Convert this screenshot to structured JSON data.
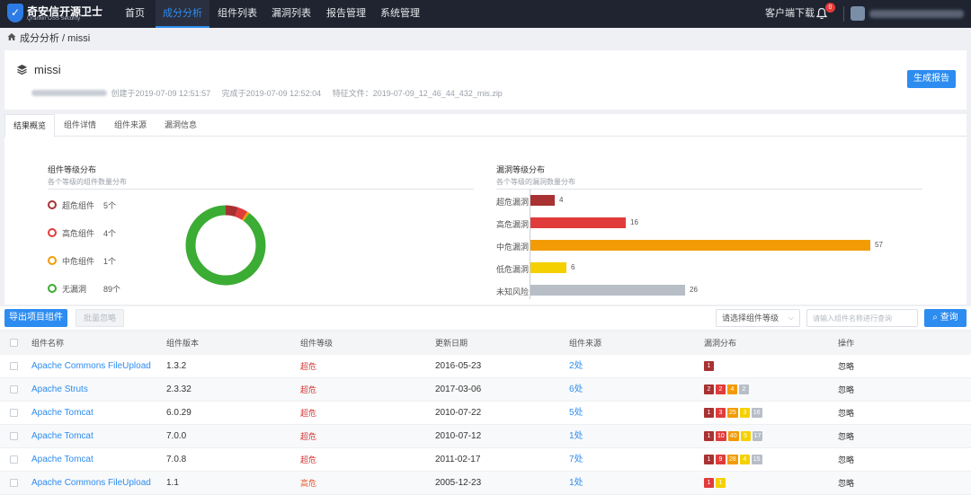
{
  "colors": {
    "accent": "#2d8cf0",
    "critical": "#a83232",
    "high": "#e03c3c",
    "medium": "#f29b05",
    "low": "#f5d000",
    "unknown": "#b8bec6",
    "safe": "#3bac34"
  },
  "nav": {
    "logo_title": "奇安信开源卫士",
    "logo_subtitle": "Qi'anxin OSS Security",
    "items": [
      "首页",
      "成分分析",
      "组件列表",
      "漏洞列表",
      "报告管理",
      "系统管理"
    ],
    "active_index": 1,
    "client_download": "客户端下载",
    "notification_count": "0"
  },
  "breadcrumb": "成分分析 / missi",
  "project": {
    "name": "missi",
    "created": "创建于2019-07-09 12:51:57",
    "completed": "完成于2019-07-09 12:52:04",
    "feature_file": "特征文件：2019-07-09_12_46_44_432_mis.zip",
    "generate_report": "生成报告"
  },
  "tabs": [
    "结果概览",
    "组件详情",
    "组件来源",
    "漏洞信息"
  ],
  "component_dist": {
    "title": "组件等级分布",
    "subtitle": "各个等级的组件数量分布",
    "legend": [
      {
        "label": "超危组件",
        "count": "5个",
        "value": 5,
        "color": "#a83232"
      },
      {
        "label": "高危组件",
        "count": "4个",
        "value": 4,
        "color": "#e03c3c"
      },
      {
        "label": "中危组件",
        "count": "1个",
        "value": 1,
        "color": "#f29b05"
      },
      {
        "label": "无漏洞",
        "count": "89个",
        "value": 89,
        "color": "#3bac34"
      }
    ]
  },
  "vuln_dist": {
    "title": "漏洞等级分布",
    "subtitle": "各个等级的漏洞数量分布"
  },
  "chart_data": {
    "type": "bar",
    "orientation": "horizontal",
    "categories": [
      "超危漏洞",
      "高危漏洞",
      "中危漏洞",
      "低危漏洞",
      "未知风险"
    ],
    "values": [
      4,
      16,
      57,
      6,
      26
    ],
    "colors": [
      "#a83232",
      "#e03c3c",
      "#f29b05",
      "#f5d000",
      "#b8bec6"
    ],
    "xlim": [
      0,
      60
    ]
  },
  "toolbar": {
    "export": "导出项目组件",
    "batch_ignore": "批量忽略",
    "level_select": "请选择组件等级",
    "search_placeholder": "请输入组件名称进行查询",
    "query": "查询"
  },
  "table": {
    "headers": [
      "组件名称",
      "组件版本",
      "组件等级",
      "更新日期",
      "组件来源",
      "漏洞分布",
      "操作"
    ],
    "rows": [
      {
        "name": "Apache Commons FileUpload",
        "version": "1.3.2",
        "level": "超危",
        "level_type": "crit",
        "date": "2016-05-23",
        "source": "2处",
        "action": "忽略",
        "vulns": [
          {
            "v": "1",
            "c": "#a83232"
          }
        ]
      },
      {
        "name": "Apache Struts",
        "version": "2.3.32",
        "level": "超危",
        "level_type": "crit",
        "date": "2017-03-06",
        "source": "6处",
        "action": "忽略",
        "vulns": [
          {
            "v": "2",
            "c": "#a83232"
          },
          {
            "v": "2",
            "c": "#e03c3c"
          },
          {
            "v": "4",
            "c": "#f29b05"
          },
          {
            "v": "2",
            "c": "#b8bec6"
          }
        ]
      },
      {
        "name": "Apache Tomcat",
        "version": "6.0.29",
        "level": "超危",
        "level_type": "crit",
        "date": "2010-07-22",
        "source": "5处",
        "action": "忽略",
        "vulns": [
          {
            "v": "1",
            "c": "#a83232"
          },
          {
            "v": "3",
            "c": "#e03c3c"
          },
          {
            "v": "25",
            "c": "#f29b05"
          },
          {
            "v": "3",
            "c": "#f5d000"
          },
          {
            "v": "16",
            "c": "#b8bec6"
          }
        ]
      },
      {
        "name": "Apache Tomcat",
        "version": "7.0.0",
        "level": "超危",
        "level_type": "crit",
        "date": "2010-07-12",
        "source": "1处",
        "action": "忽略",
        "vulns": [
          {
            "v": "1",
            "c": "#a83232"
          },
          {
            "v": "10",
            "c": "#e03c3c"
          },
          {
            "v": "40",
            "c": "#f29b05"
          },
          {
            "v": "5",
            "c": "#f5d000"
          },
          {
            "v": "17",
            "c": "#b8bec6"
          }
        ]
      },
      {
        "name": "Apache Tomcat",
        "version": "7.0.8",
        "level": "超危",
        "level_type": "crit",
        "date": "2011-02-17",
        "source": "7处",
        "action": "忽略",
        "vulns": [
          {
            "v": "1",
            "c": "#a83232"
          },
          {
            "v": "9",
            "c": "#e03c3c"
          },
          {
            "v": "28",
            "c": "#f29b05"
          },
          {
            "v": "4",
            "c": "#f5d000"
          },
          {
            "v": "15",
            "c": "#b8bec6"
          }
        ]
      },
      {
        "name": "Apache Commons FileUpload",
        "version": "1.1",
        "level": "高危",
        "level_type": "high",
        "date": "2005-12-23",
        "source": "1处",
        "action": "忽略",
        "vulns": [
          {
            "v": "1",
            "c": "#e03c3c"
          },
          {
            "v": "1",
            "c": "#f5d000"
          }
        ]
      }
    ]
  }
}
